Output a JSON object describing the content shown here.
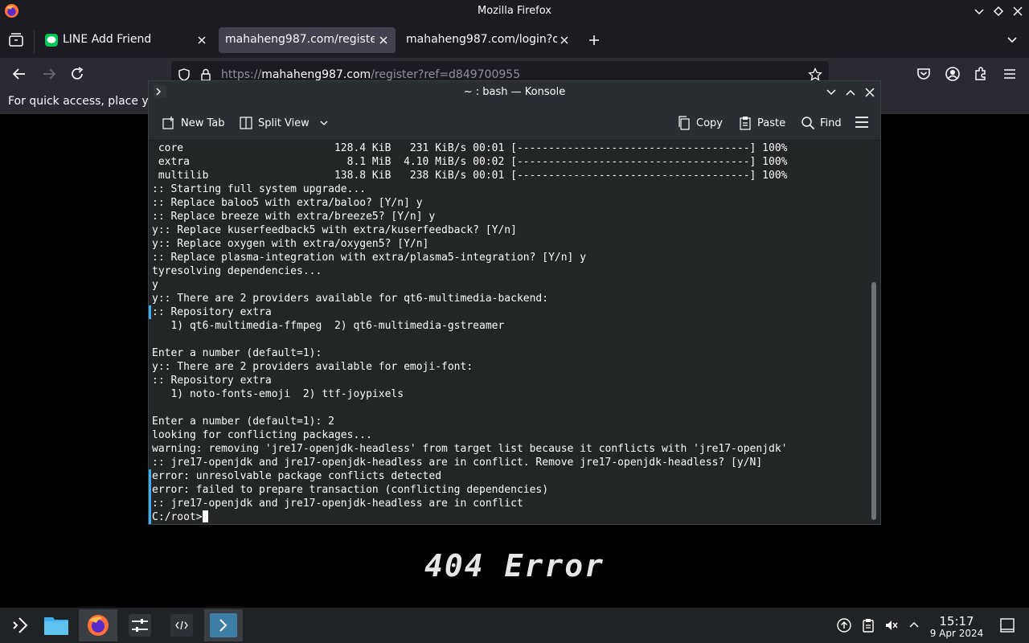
{
  "window": {
    "title": "Mozilla Firefox"
  },
  "tabs": [
    {
      "label": "LINE Add Friend",
      "selected": false
    },
    {
      "label": "mahaheng987.com/register",
      "selected": true
    },
    {
      "label": "mahaheng987.com/login?op",
      "selected": false
    }
  ],
  "navbar": {
    "url_prefix": "https://",
    "url_host": "mahaheng987.com",
    "url_path": "/register?ref=d849700955"
  },
  "bookmarks_notice": "For quick access, place yo",
  "page": {
    "error_text": "404 Error"
  },
  "konsole": {
    "title": "~ : bash — Konsole",
    "toolbar": {
      "new_tab": "New Tab",
      "split_view": "Split View",
      "copy": "Copy",
      "paste": "Paste",
      "find": "Find"
    },
    "lines": [
      " core                        128.4 KiB   231 KiB/s 00:01 [-------------------------------------] 100%",
      " extra                         8.1 MiB  4.10 MiB/s 00:02 [-------------------------------------] 100%",
      " multilib                    138.8 KiB   238 KiB/s 00:01 [-------------------------------------] 100%",
      ":: Starting full system upgrade...",
      ":: Replace baloo5 with extra/baloo? [Y/n] y",
      ":: Replace breeze with extra/breeze5? [Y/n] y",
      "y:: Replace kuserfeedback5 with extra/kuserfeedback? [Y/n]",
      "y:: Replace oxygen with extra/oxygen5? [Y/n]",
      ":: Replace plasma-integration with extra/plasma5-integration? [Y/n] y",
      "tyresolving dependencies...",
      "y",
      "y:: There are 2 providers available for qt6-multimedia-backend:",
      ":: Repository extra",
      "   1) qt6-multimedia-ffmpeg  2) qt6-multimedia-gstreamer",
      "",
      "Enter a number (default=1):",
      "y:: There are 2 providers available for emoji-font:",
      ":: Repository extra",
      "   1) noto-fonts-emoji  2) ttf-joypixels",
      "",
      "Enter a number (default=1): 2",
      "looking for conflicting packages...",
      "warning: removing 'jre17-openjdk-headless' from target list because it conflicts with 'jre17-openjdk'",
      ":: jre17-openjdk and jre17-openjdk-headless are in conflict. Remove jre17-openjdk-headless? [y/N]",
      "error: unresolvable package conflicts detected",
      "error: failed to prepare transaction (conflicting dependencies)",
      ":: jre17-openjdk and jre17-openjdk-headless are in conflict"
    ],
    "prompt": "C:/root>"
  },
  "taskbar": {
    "clock_time": "15:17",
    "clock_date": "9 Apr 2024"
  },
  "colors": {
    "firefox_chrome": "#1c1b22",
    "firefox_navbar": "#2b2a33",
    "konsole_bg": "#232627",
    "breeze_accent": "#3daee9",
    "taskbar_bg": "#202326"
  }
}
